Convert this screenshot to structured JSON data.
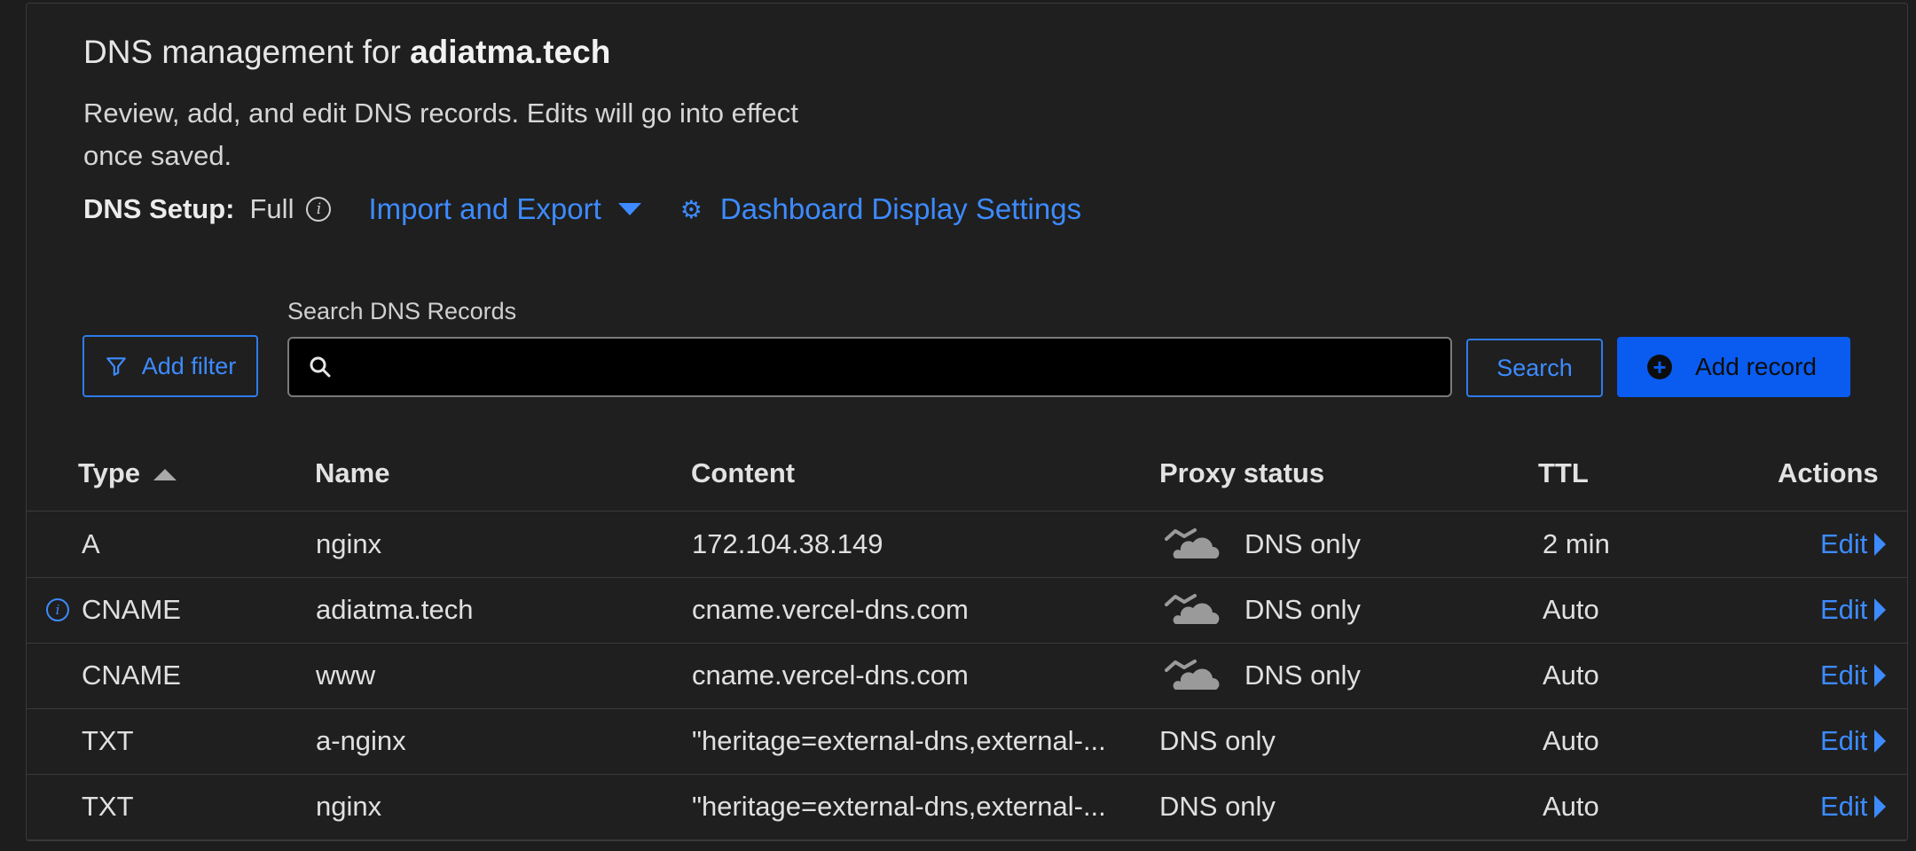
{
  "header": {
    "title_prefix": "DNS management for ",
    "domain": "adiatma.tech",
    "description": "Review, add, and edit DNS records. Edits will go into effect once saved.",
    "setup_label": "DNS Setup:",
    "setup_value": "Full",
    "import_export_label": "Import and Export",
    "display_settings_label": "Dashboard Display Settings"
  },
  "toolbar": {
    "add_filter_label": "Add filter",
    "search_label": "Search DNS Records",
    "search_value": "",
    "search_button_label": "Search",
    "add_record_label": "Add record"
  },
  "table": {
    "columns": [
      "Type",
      "Name",
      "Content",
      "Proxy status",
      "TTL",
      "Actions"
    ],
    "rows": [
      {
        "type": "A",
        "name": "nginx",
        "content": "172.104.38.149",
        "proxy": "DNS only",
        "ttl": "2 min",
        "action": "Edit"
      },
      {
        "type": "CNAME",
        "name": "adiatma.tech",
        "content": "cname.vercel-dns.com",
        "proxy": "DNS only",
        "ttl": "Auto",
        "action": "Edit"
      },
      {
        "type": "CNAME",
        "name": "www",
        "content": "cname.vercel-dns.com",
        "proxy": "DNS only",
        "ttl": "Auto",
        "action": "Edit"
      },
      {
        "type": "TXT",
        "name": "a-nginx",
        "content": "\"heritage=external-dns,external-...",
        "proxy": "DNS only",
        "ttl": "Auto",
        "action": "Edit"
      },
      {
        "type": "TXT",
        "name": "nginx",
        "content": "\"heritage=external-dns,external-...",
        "proxy": "DNS only",
        "ttl": "Auto",
        "action": "Edit"
      }
    ]
  },
  "icons": {
    "setup_info": "info-icon",
    "import_caret": "chevron-down-icon",
    "settings": "gear-icon",
    "filter": "filter-icon",
    "search": "search-icon",
    "add": "plus-circle-icon",
    "sort": "sort-ascending-icon",
    "cname_info": "info-icon",
    "proxy": "dns-only-cloud-icon",
    "edit": "caret-right-icon"
  },
  "colors": {
    "background": "#1f1f1f",
    "accent": "#3d8bff",
    "primary_button": "#0a5cf0",
    "border": "#3a3a3a"
  }
}
